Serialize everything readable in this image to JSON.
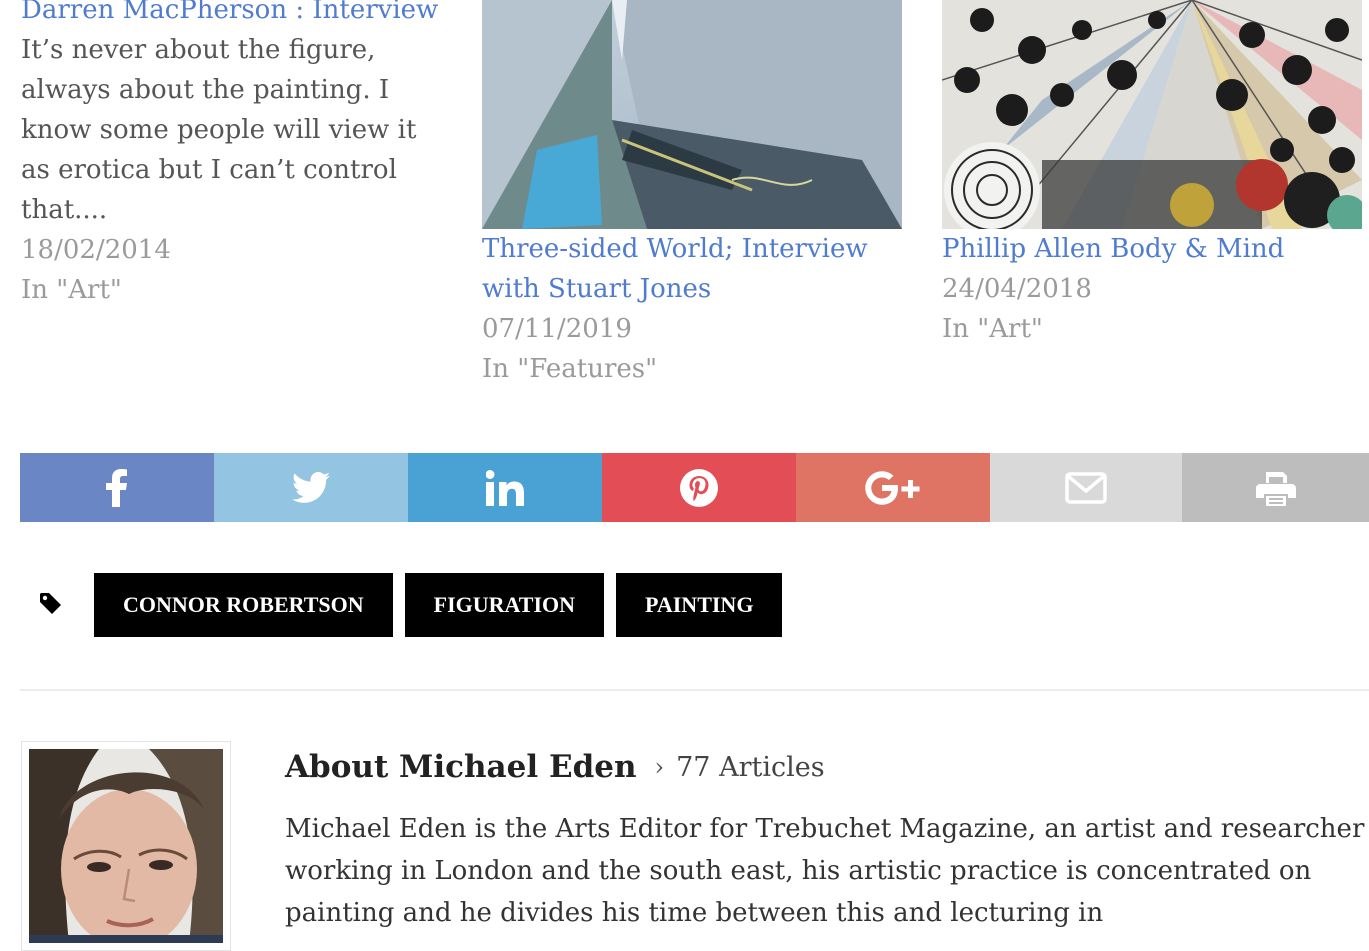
{
  "related": [
    {
      "title": "Darren MacPherson : Interview",
      "excerpt": "It’s never about the figure, always about the painting. I know some people will view it as erotica but I can’t control that....",
      "date": "18/02/2014",
      "category": "In \"Art\""
    },
    {
      "title": "Three-sided World; Interview with Stuart Jones",
      "date": "07/11/2019",
      "category": "In \"Features\""
    },
    {
      "title": "Phillip Allen Body & Mind",
      "date": "24/04/2018",
      "category": "In \"Art\""
    }
  ],
  "share": [
    {
      "network": "facebook",
      "icon": "facebook-icon",
      "color": "#6a86c5"
    },
    {
      "network": "twitter",
      "icon": "twitter-icon",
      "color": "#93c4e2"
    },
    {
      "network": "linkedin",
      "icon": "linkedin-icon",
      "color": "#4aa1d3"
    },
    {
      "network": "pinterest",
      "icon": "pinterest-icon",
      "color": "#e34d55"
    },
    {
      "network": "google-plus",
      "icon": "google-plus-icon",
      "color": "#df7464"
    },
    {
      "network": "email",
      "icon": "mail-icon",
      "color": "#d9d9d9"
    },
    {
      "network": "print",
      "icon": "print-icon",
      "color": "#bdbdbd"
    }
  ],
  "tags": [
    "CONNOR ROBERTSON",
    "FIGURATION",
    "PAINTING"
  ],
  "author": {
    "heading": "About Michael Eden",
    "article_count": "77 Articles",
    "bio": "Michael Eden is the Arts Editor for Trebuchet Magazine, an artist and researcher working in London and the south east, his artistic practice is concentrated on painting and he divides his time between this and lecturing in"
  }
}
